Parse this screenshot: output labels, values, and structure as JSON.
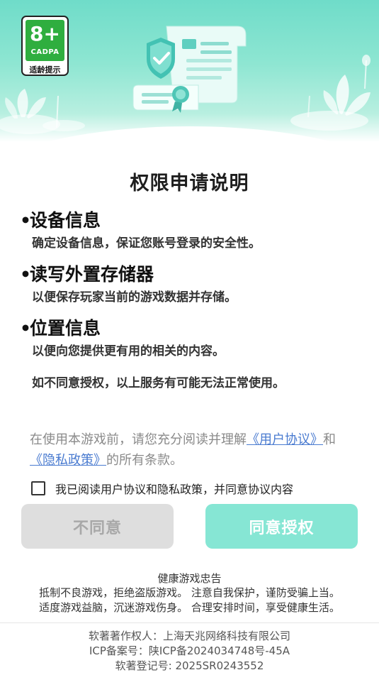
{
  "badge": {
    "age": "8+",
    "org": "CADPA",
    "hint": "适龄提示"
  },
  "title": "权限申请说明",
  "permissions": [
    {
      "name": "设备信息",
      "desc": "确定设备信息，保证您账号登录的安全性。"
    },
    {
      "name": "读写外置存储器",
      "desc": "以便保存玩家当前的游戏数据并存储。"
    },
    {
      "name": "位置信息",
      "desc": "以便向您提供更有用的相关的内容。"
    }
  ],
  "bullet": "•",
  "warning": "如不同意授权，以上服务有可能无法正常使用。",
  "notice": {
    "prefix": "在使用本游戏前，请您充分阅读并理解",
    "user_agreement": "《用户协议》",
    "and": "和",
    "privacy_policy": "《隐私政策》",
    "suffix": "的所有条款。"
  },
  "agree_checkbox": {
    "label": "我已阅读用户协议和隐私政策，并同意协议内容",
    "checked": false
  },
  "buttons": {
    "disagree": "不同意",
    "agree": "同意授权"
  },
  "health": {
    "title": "健康游戏忠告",
    "line1": "抵制不良游戏，拒绝盗版游戏。 注意自我保护，谨防受骗上当。",
    "line2": "适度游戏益脑，沉迷游戏伤身。 合理安排时间，享受健康生活。"
  },
  "footer": {
    "copyright_owner": "软著著作权人：上海天兆网络科技有限公司",
    "icp": "ICP备案号：陕ICP备2024034748号-45A",
    "software_reg": "软著登记号: 2025SR0243552"
  },
  "colors": {
    "banner": "#6fdcc9",
    "badge_green": "#2fae3f",
    "link": "#4a7bd0",
    "agree_button": "#86e6d4",
    "disagree_button": "#dedede"
  }
}
